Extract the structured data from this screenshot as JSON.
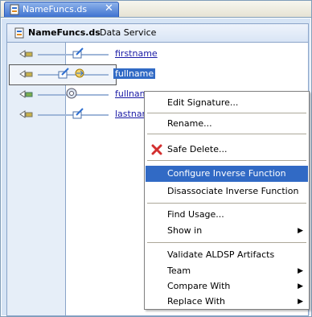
{
  "tab": {
    "title": "NameFuncs.ds",
    "close_glyph": "✕"
  },
  "header": {
    "name": "NameFuncs.ds",
    "type": "Data Service"
  },
  "operations": [
    {
      "label": "firstname",
      "icon": "function-icon"
    },
    {
      "label": "fullname",
      "icon": "function-icon",
      "selected": true
    },
    {
      "label": "fullname",
      "icon": "gear-icon"
    },
    {
      "label": "lastname",
      "icon": "function-icon"
    }
  ],
  "context_menu": {
    "items": [
      {
        "label": "Edit Signature..."
      },
      {
        "label": "Rename..."
      },
      {
        "label": "Safe Delete...",
        "icon": "red-x-icon"
      },
      {
        "label": "Configure Inverse Function",
        "highlighted": true
      },
      {
        "label": "Disassociate Inverse Function"
      },
      {
        "label": "Find Usage..."
      },
      {
        "label": "Show in",
        "submenu": true
      },
      {
        "label": "Validate ALDSP Artifacts"
      },
      {
        "label": "Team",
        "submenu": true
      },
      {
        "label": "Compare With",
        "submenu": true
      },
      {
        "label": "Replace With",
        "submenu": true
      }
    ],
    "submenu_glyph": "▶"
  },
  "colors": {
    "selection": "#316ac5",
    "link": "#1a1aa6",
    "delete_icon": "#d32f2f"
  }
}
